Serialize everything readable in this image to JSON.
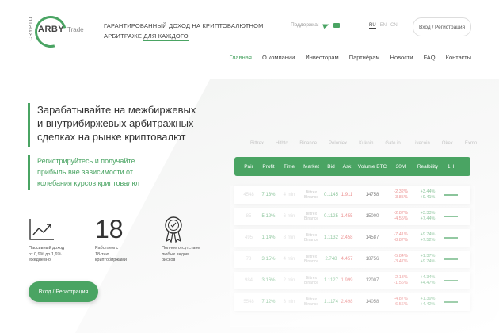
{
  "logo": {
    "crypto": "CRYPTO",
    "arby": "ARBY",
    "trade": "Trade"
  },
  "header": {
    "tagline_line1": "ГАРАНТИРОВАННЫЙ ДОХОД НА КРИПТОВАЛЮТНОМ",
    "tagline_line2_a": "АРБИТРАЖЕ ",
    "tagline_line2_b": "ДЛЯ КАЖДОГО",
    "support_label": "Поддержка:",
    "langs": [
      "RU",
      "EN",
      "CN"
    ],
    "login_label": "Вход / Регистрация"
  },
  "nav": [
    "Главная",
    "О компании",
    "Инвесторам",
    "Партнёрам",
    "Новости",
    "FAQ",
    "Контакты"
  ],
  "hero": {
    "title_lines": [
      "Зарабатывайте на межбиржевых",
      "и внутрибиржевых арбитражных",
      "сделках на рынке криптовалют"
    ],
    "sub_lines": [
      "Регистрируйтесь и получайте",
      "прибыль вне зависимости от",
      "колебания курсов криптовалют"
    ]
  },
  "features": [
    {
      "icon": "chart-growth-icon",
      "lines": [
        "Пассивный доход",
        "от 0,9% до 1,6%",
        "ежедневно"
      ]
    },
    {
      "big": "18",
      "lines": [
        "Работаем с",
        "18-тью",
        "криптобиржами"
      ]
    },
    {
      "icon": "award-medal-icon",
      "lines": [
        "Полное отсутствие",
        "любых видов",
        "рисков"
      ]
    }
  ],
  "main_button": "Вход / Регистрация",
  "exchanges": [
    "Bittrex",
    "Hitbtc",
    "Binance",
    "Poloniex",
    "Kukoin",
    "Gate.io",
    "Livecoin",
    "Okex",
    "Exmo"
  ],
  "table": {
    "headers": [
      "Pair",
      "Profit",
      "Time",
      "Market",
      "Bid",
      "Ask",
      "Volume BTC",
      "30M",
      "Realbility",
      "1H"
    ],
    "rows": [
      {
        "pair": "4548",
        "profit": "7.13%",
        "time": "4 min",
        "m1": "Bittrex",
        "m2": "Binance",
        "bid": "0.1145",
        "ask": "1.911",
        "vol": "14758",
        "m30a": "-2.32%",
        "m30b": "-3.85%",
        "r1": "+3.44%",
        "r2": "+9.41%"
      },
      {
        "pair": "85",
        "profit": "5.12%",
        "time": "6 min",
        "m1": "Bittrex",
        "m2": "Binance",
        "bid": "0.1125",
        "ask": "1.455",
        "vol": "15000",
        "m30a": "-2.87%",
        "m30b": "-4.55%",
        "r1": "+3.33%",
        "r2": "+7.44%"
      },
      {
        "pair": "495",
        "profit": "1.14%",
        "time": "8 min",
        "m1": "Bittrex",
        "m2": "Binance",
        "bid": "1.1132",
        "ask": "2.458",
        "vol": "14587",
        "m30a": "-7.41%",
        "m30b": "-8.87%",
        "r1": "+9.74%",
        "r2": "+7.52%"
      },
      {
        "pair": "78",
        "profit": "3.15%",
        "time": "4 min",
        "m1": "Bittrex",
        "m2": "Binance",
        "bid": "2.748",
        "ask": "4.457",
        "vol": "18756",
        "m30a": "-5.84%",
        "m30b": "-3.47%",
        "r1": "+1.37%",
        "r2": "+9.74%"
      },
      {
        "pair": "984",
        "profit": "3.16%",
        "time": "2 min",
        "m1": "Bittrex",
        "m2": "Binance",
        "bid": "1.1127",
        "ask": "1.999",
        "vol": "12007",
        "m30a": "-2.13%",
        "m30b": "-1.56%",
        "r1": "+4.34%",
        "r2": "+4.47%"
      },
      {
        "pair": "5548",
        "profit": "7.12%",
        "time": "3 min",
        "m1": "Bittrex",
        "m2": "Binance",
        "bid": "1.1174",
        "ask": "2.498",
        "vol": "14058",
        "m30a": "-4.87%",
        "m30b": "-6.56%",
        "r1": "+1.39%",
        "r2": "+4.42%"
      }
    ]
  },
  "colors": {
    "accent": "#4aa463",
    "negative": "#e05050"
  }
}
